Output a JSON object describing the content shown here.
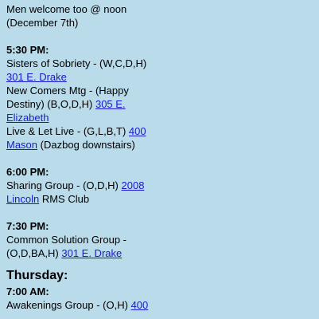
{
  "intro": {
    "line1": "Men welcome too @ noon",
    "line2": "(December 7th)"
  },
  "block_530": {
    "time": "5:30 PM:",
    "m1_name": "Sisters of Sobriety - (W,C,D,H)",
    "m1_link": "301 E. Drake",
    "m2_name": "New Comers Mtg - (Happy Destiny) (B,O,D,H)",
    "m2_link": "305 E. Elizabeth",
    "m3_name": "Live & Let Live - (G,L,B,T)",
    "m3_link": "400 Mason",
    "m3_note": "(Dazbog downstairs)"
  },
  "block_600": {
    "time": "6:00 PM:",
    "m1_name": "Sharing Group - (O,D,H)",
    "m1_link": "2008 Lincoln",
    "m1_note": "RMS Club"
  },
  "block_730": {
    "time": "7:30 PM:",
    "m1_name": "Common Solution Group - (O,D,BA,H)",
    "m1_link": "301 E. Drake"
  },
  "thursday": {
    "day": "Thursday:",
    "time": "7:00 AM:",
    "m1_name": "Awakenings Group - (O,H)",
    "m1_link": "400"
  }
}
